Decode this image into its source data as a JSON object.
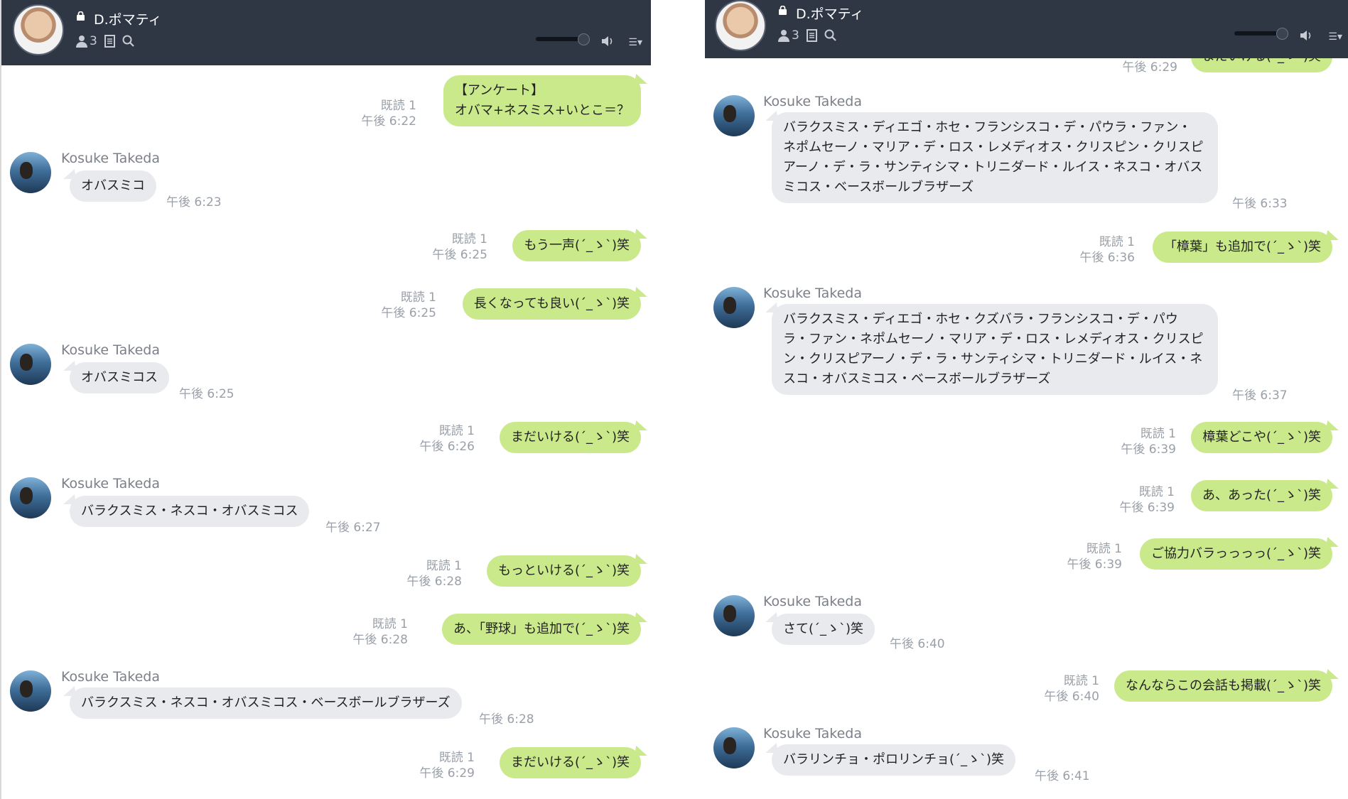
{
  "chat": {
    "title": "D.ポマティ",
    "member_count": "3",
    "sender_name": "Kosuke Takeda",
    "read_label": "既読 1",
    "colors": {
      "header_bg": "#2f3644",
      "bubble_out": "#c9e98a",
      "bubble_in": "#e8eaed"
    },
    "icons": [
      "lock-icon",
      "members-icon",
      "notes-icon",
      "search-icon",
      "volume-icon",
      "menu-icon"
    ]
  },
  "left": {
    "messages": [
      {
        "dir": "out",
        "text": "【アンケート】\nオバマ+ネスミス+いとこ＝？",
        "time": "午後 6:22",
        "read": "既読 1"
      },
      {
        "dir": "in",
        "text": "オバスミコ",
        "time": "午後 6:23"
      },
      {
        "dir": "out",
        "text": "もう一声(´_ゝ`)笑",
        "time": "午後 6:25",
        "read": "既読 1"
      },
      {
        "dir": "out",
        "text": "長くなっても良い(´_ゝ`)笑",
        "time": "午後 6:25",
        "read": "既読 1"
      },
      {
        "dir": "in",
        "text": "オバスミコス",
        "time": "午後 6:25"
      },
      {
        "dir": "out",
        "text": "まだいける(´_ゝ`)笑",
        "time": "午後 6:26",
        "read": "既読 1"
      },
      {
        "dir": "in",
        "text": "バラクスミス・ネスコ・オバスミコス",
        "time": "午後 6:27"
      },
      {
        "dir": "out",
        "text": "もっといける(´_ゝ`)笑",
        "time": "午後 6:28",
        "read": "既読 1"
      },
      {
        "dir": "out",
        "text": "あ、「野球」も追加で(´_ゝ`)笑",
        "time": "午後 6:28",
        "read": "既読 1"
      },
      {
        "dir": "in",
        "text": "バラクスミス・ネスコ・オバスミコス・ベースボールブラザーズ",
        "time": "午後 6:28"
      },
      {
        "dir": "out",
        "text": "まだいける(´_ゝ`)笑",
        "time": "午後 6:29",
        "read": "既読 1"
      }
    ]
  },
  "right": {
    "partial_top": {
      "text": "まだいける(´_ゝ`)笑",
      "time": "午後 6:29"
    },
    "messages": [
      {
        "dir": "in",
        "text": "バラクスミス・ディエゴ・ホセ・フランシスコ・デ・パウラ・ファン・\nネポムセーノ・マリア・デ・ロス・レメディオス・クリスピン・クリスピ\nアーノ・デ・ラ・サンティシマ・トリニダード・ルイス・ネスコ・オバス\nミコス・ベースボールブラザーズ",
        "time": "午後 6:33"
      },
      {
        "dir": "out",
        "text": "「樟葉」も追加で(´_ゝ`)笑",
        "time": "午後 6:36",
        "read": "既読 1"
      },
      {
        "dir": "in",
        "text": "バラクスミス・ディエゴ・ホセ・クズバラ・フランシスコ・デ・パウ\nラ・ファン・ネポムセーノ・マリア・デ・ロス・レメディオス・クリスピ\nン・クリスピアーノ・デ・ラ・サンティシマ・トリニダード・ルイス・ネ\nスコ・オバスミコス・ベースボールブラザーズ",
        "time": "午後 6:37"
      },
      {
        "dir": "out",
        "text": "樟葉どこや(´_ゝ`)笑",
        "time": "午後 6:39",
        "read": "既読 1"
      },
      {
        "dir": "out",
        "text": "あ、あった(´_ゝ`)笑",
        "time": "午後 6:39",
        "read": "既読 1"
      },
      {
        "dir": "out",
        "text": "ご協力バラっっっっ(´_ゝ`)笑",
        "time": "午後 6:39",
        "read": "既読 1"
      },
      {
        "dir": "in",
        "text": "さて(´_ゝ`)笑",
        "time": "午後 6:40"
      },
      {
        "dir": "out",
        "text": "なんならこの会話も掲載(´_ゝ`)笑",
        "time": "午後 6:40",
        "read": "既読 1"
      },
      {
        "dir": "in",
        "text": "バラリンチョ・ポロリンチョ(´_ゝ`)笑",
        "time": "午後 6:41"
      }
    ]
  }
}
